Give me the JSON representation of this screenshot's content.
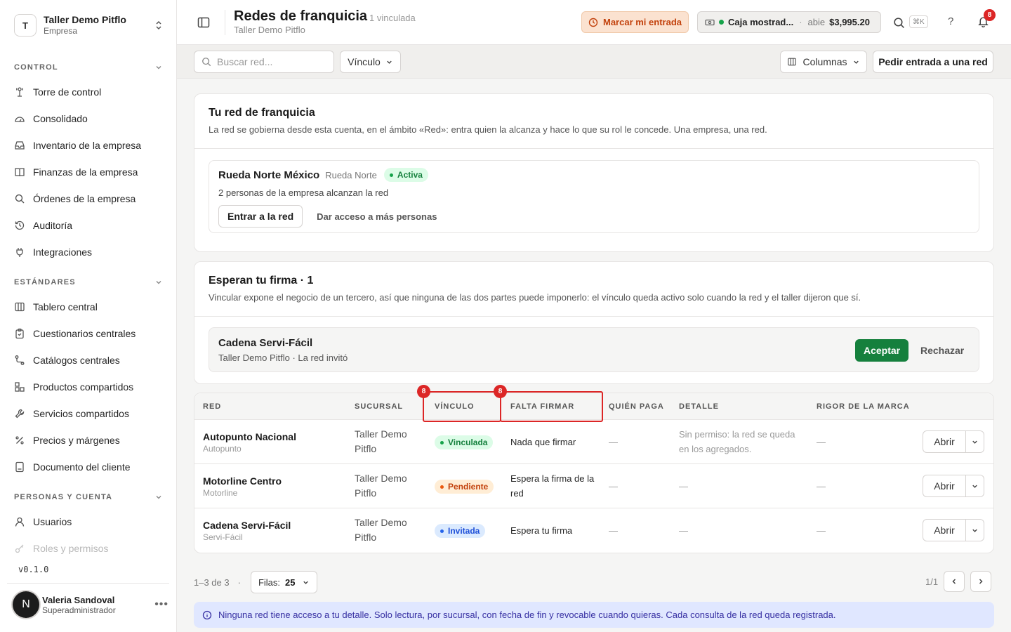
{
  "workspace": {
    "initial": "T",
    "name": "Taller Demo Pitflo",
    "type": "Empresa"
  },
  "sidebar": {
    "sections": [
      {
        "title": "CONTROL",
        "items": [
          {
            "label": "Torre de control",
            "icon": "tower-icon"
          },
          {
            "label": "Consolidado",
            "icon": "gauge-icon"
          },
          {
            "label": "Inventario de la empresa",
            "icon": "inbox-icon"
          },
          {
            "label": "Finanzas de la empresa",
            "icon": "book-icon"
          },
          {
            "label": "Órdenes de la empresa",
            "icon": "search-icon"
          },
          {
            "label": "Auditoría",
            "icon": "history-icon"
          },
          {
            "label": "Integraciones",
            "icon": "plug-icon"
          }
        ]
      },
      {
        "title": "ESTÁNDARES",
        "items": [
          {
            "label": "Tablero central",
            "icon": "columns-icon"
          },
          {
            "label": "Cuestionarios centrales",
            "icon": "clipboard-icon"
          },
          {
            "label": "Catálogos centrales",
            "icon": "route-icon"
          },
          {
            "label": "Productos compartidos",
            "icon": "boxes-icon"
          },
          {
            "label": "Servicios compartidos",
            "icon": "wrench-icon"
          },
          {
            "label": "Precios y márgenes",
            "icon": "percent-icon"
          },
          {
            "label": "Documento del cliente",
            "icon": "document-icon"
          }
        ]
      },
      {
        "title": "PERSONAS Y CUENTA",
        "items": [
          {
            "label": "Usuarios",
            "icon": "user-icon"
          },
          {
            "label": "Roles y permisos",
            "icon": "key-icon"
          }
        ]
      }
    ],
    "version": "v0.1.0",
    "user": {
      "initial": "N",
      "name": "Valeria Sandoval",
      "role": "Superadministrador"
    }
  },
  "topbar": {
    "title": "Redes de franquicia",
    "count": "1 vinculada",
    "breadcrumb": "Taller Demo Pitflo",
    "clock_in_label": "Marcar mi entrada",
    "register": {
      "name": "Caja mostrad...",
      "separator": "·",
      "status": "abie",
      "amount": "$3,995.20"
    },
    "shortcut": "⌘K",
    "help": "?",
    "notifications": "8"
  },
  "toolbar": {
    "search_placeholder": "Buscar red...",
    "filter_label": "Vínculo",
    "columns_label": "Columnas",
    "request_label": "Pedir entrada a una red"
  },
  "own_network": {
    "title": "Tu red de franquicia",
    "description": "La red se gobierna desde esta cuenta, en el ámbito «Red»: entra quien la alcanza y hace lo que su rol le concede. Una empresa, una red.",
    "name": "Rueda Norte México",
    "short": "Rueda Norte",
    "status": "Activa",
    "reach": "2 personas de la empresa alcanzan la red",
    "enter_label": "Entrar a la red",
    "grant_label": "Dar acceso a más personas"
  },
  "pending": {
    "title": "Esperan tu firma · 1",
    "description": "Vincular expone el negocio de un tercero, así que ninguna de las dos partes puede imponerlo: el vínculo queda activo solo cuando la red y el taller dijeron que sí.",
    "name": "Cadena Servi-Fácil",
    "meta": "Taller Demo Pitflo · La red invitó",
    "accept_label": "Aceptar",
    "reject_label": "Rechazar"
  },
  "table": {
    "headers": [
      "RED",
      "SUCURSAL",
      "VÍNCULO",
      "FALTA FIRMAR",
      "QUIÉN PAGA",
      "DETALLE",
      "RIGOR DE LA MARCA"
    ],
    "highlight_badge": "8",
    "rows": [
      {
        "name": "Autopunto Nacional",
        "short": "Autopunto",
        "branch": "Taller Demo Pitflo",
        "link": "Vinculada",
        "sign": "Nada que firmar",
        "payer": "—",
        "detail": "Sin permiso: la red se queda en los agregados.",
        "rigor": "—",
        "action": "Abrir"
      },
      {
        "name": "Motorline Centro",
        "short": "Motorline",
        "branch": "Taller Demo Pitflo",
        "link": "Pendiente",
        "sign": "Espera la firma de la red",
        "payer": "—",
        "detail": "—",
        "rigor": "—",
        "action": "Abrir"
      },
      {
        "name": "Cadena Servi-Fácil",
        "short": "Servi-Fácil",
        "branch": "Taller Demo Pitflo",
        "link": "Invitada",
        "sign": "Espera tu firma",
        "payer": "—",
        "detail": "—",
        "rigor": "—",
        "action": "Abrir"
      }
    ]
  },
  "pagination": {
    "range": "1–3 de 3",
    "sep": "·",
    "rows_label": "Filas:",
    "rows_value": "25",
    "page": "1/1"
  },
  "info": "Ninguna red tiene acceso a tu detalle. Solo lectura, por sucursal, con fecha de fin y revocable cuando quieras. Cada consulta de la red queda registrada.",
  "colors": {
    "accent_green": "#15803d",
    "warning": "#c2410c",
    "danger": "#dc2626",
    "info_bg": "#e0e7ff"
  }
}
